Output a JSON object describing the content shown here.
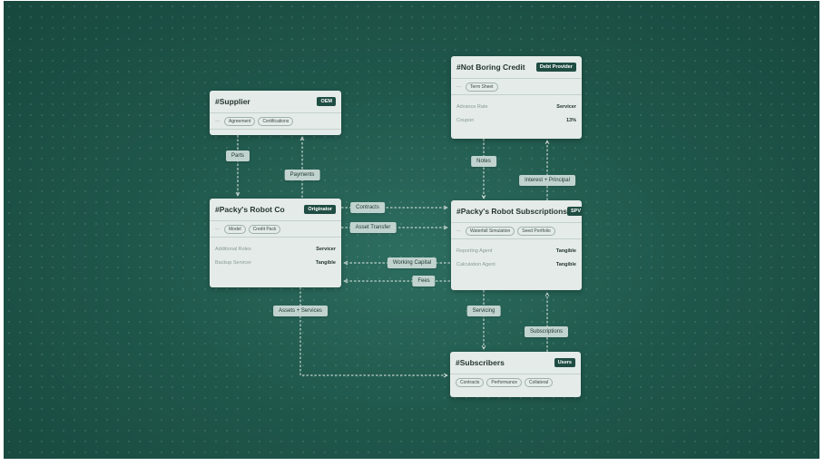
{
  "nodes": {
    "supplier": {
      "title": "#Supplier",
      "badge": "OEM",
      "dash": "—",
      "chips": [
        "Agreement",
        "Certifications"
      ]
    },
    "not_boring": {
      "title": "#Not Boring Credit",
      "badge": "Debt Provider",
      "dash": "—",
      "chips": [
        "Term Sheet"
      ],
      "rows": [
        {
          "k": "Advance Rate",
          "v": "Servicer"
        },
        {
          "k": "Coupon",
          "v": "13%"
        }
      ]
    },
    "robot_co": {
      "title": "#Packy's Robot Co",
      "badge": "Originator",
      "dash": "—",
      "chips": [
        "Model",
        "Credit Pack"
      ],
      "rows": [
        {
          "k": "Additional Roles",
          "v": "Servicer"
        },
        {
          "k": "Backup Servicer",
          "v": "Tangible"
        }
      ]
    },
    "subscriptions": {
      "title": "#Packy's Robot Subscriptions",
      "badge": "SPV",
      "dash": "—",
      "chips": [
        "Waterfall Simulation",
        "Seed Portfolio"
      ],
      "rows": [
        {
          "k": "Reporting Agent",
          "v": "Tangible"
        },
        {
          "k": "Calculation Agent",
          "v": "Tangible"
        }
      ]
    },
    "subscribers": {
      "title": "#Subscribers",
      "badge": "Users",
      "chips": [
        "Contracts",
        "Performance",
        "Collateral"
      ]
    }
  },
  "edges": {
    "parts": "Parts",
    "payments": "Payments",
    "notes": "Notes",
    "interest_principal": "Interest + Principal",
    "contracts": "Contracts",
    "asset_transfer": "Asset Transfer",
    "working_capital": "Working Capital",
    "fees": "Fees",
    "assets_services": "Assets + Services",
    "servicing": "Servicing",
    "subscriptions": "Subscriptions"
  }
}
